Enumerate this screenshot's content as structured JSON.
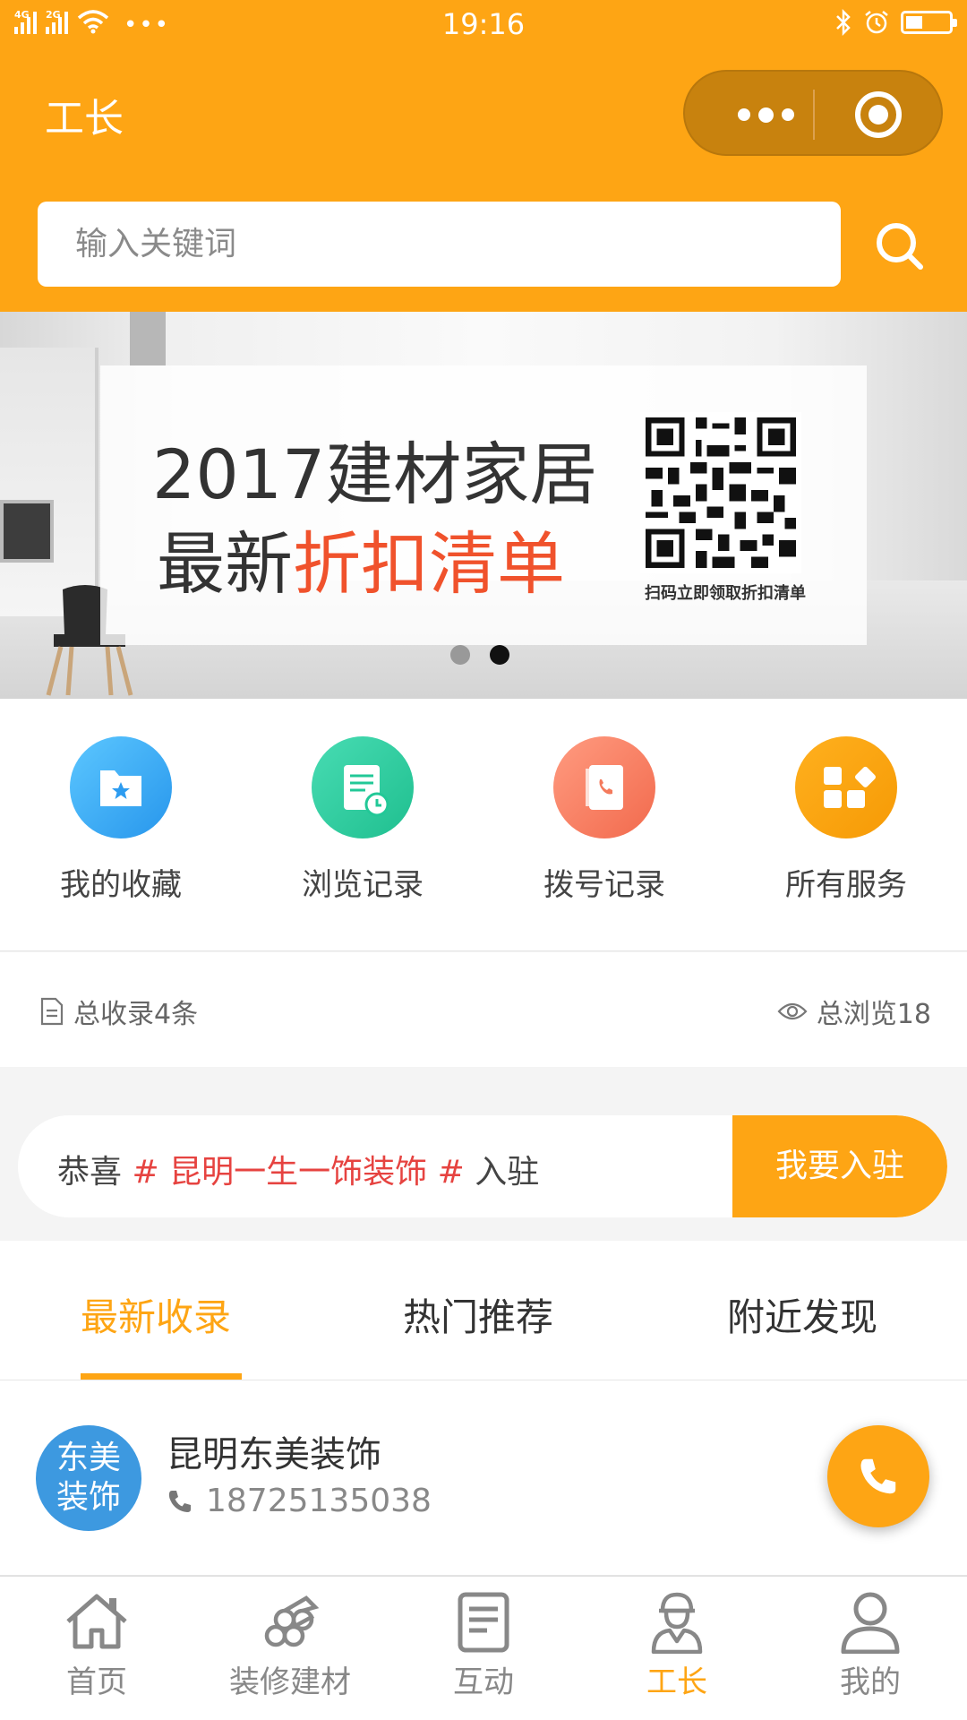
{
  "status_bar": {
    "network_1": "4G",
    "network_2": "2G",
    "time": "19:16",
    "battery_level": 0.35
  },
  "nav": {
    "title": "工长"
  },
  "search": {
    "placeholder": "输入关键词"
  },
  "banner": {
    "line1_year": "2017",
    "line1_text": "建材家居",
    "line2_prefix": "最新",
    "line2_highlight": "折扣清单",
    "qr_caption": "扫码立即领取折扣清单",
    "slide_count": 2,
    "active_slide": 2
  },
  "services": [
    {
      "label": "我的收藏",
      "icon": "folder-star-icon",
      "color": "#2d9cf0"
    },
    {
      "label": "浏览记录",
      "icon": "history-doc-icon",
      "color": "#22c897"
    },
    {
      "label": "拨号记录",
      "icon": "phone-book-icon",
      "color": "#f47a5c"
    },
    {
      "label": "所有服务",
      "icon": "grid-services-icon",
      "color": "#f89d09"
    }
  ],
  "stats": {
    "total_records": "总收录4条",
    "total_views": "总浏览18"
  },
  "join": {
    "prefix": "恭喜",
    "hash": "#",
    "company": "昆明一生一饰装饰",
    "suffix": "入驻",
    "button": "我要入驻"
  },
  "tabs": [
    {
      "label": "最新收录",
      "active": true
    },
    {
      "label": "热门推荐",
      "active": false
    },
    {
      "label": "附近发现",
      "active": false
    }
  ],
  "listings": [
    {
      "avatar_line1": "东美",
      "avatar_line2": "装饰",
      "name": "昆明东美装饰",
      "phone": "18725135038"
    }
  ],
  "tabbar": [
    {
      "label": "首页",
      "icon": "home-icon",
      "active": false
    },
    {
      "label": "装修建材",
      "icon": "building-materials-icon",
      "active": false
    },
    {
      "label": "互动",
      "icon": "interaction-icon",
      "active": false
    },
    {
      "label": "工长",
      "icon": "foreman-icon",
      "active": true
    },
    {
      "label": "我的",
      "icon": "user-icon",
      "active": false
    }
  ],
  "colors": {
    "brand": "#fea514",
    "highlight_red": "#e64340",
    "banner_accent": "#f0522c"
  }
}
